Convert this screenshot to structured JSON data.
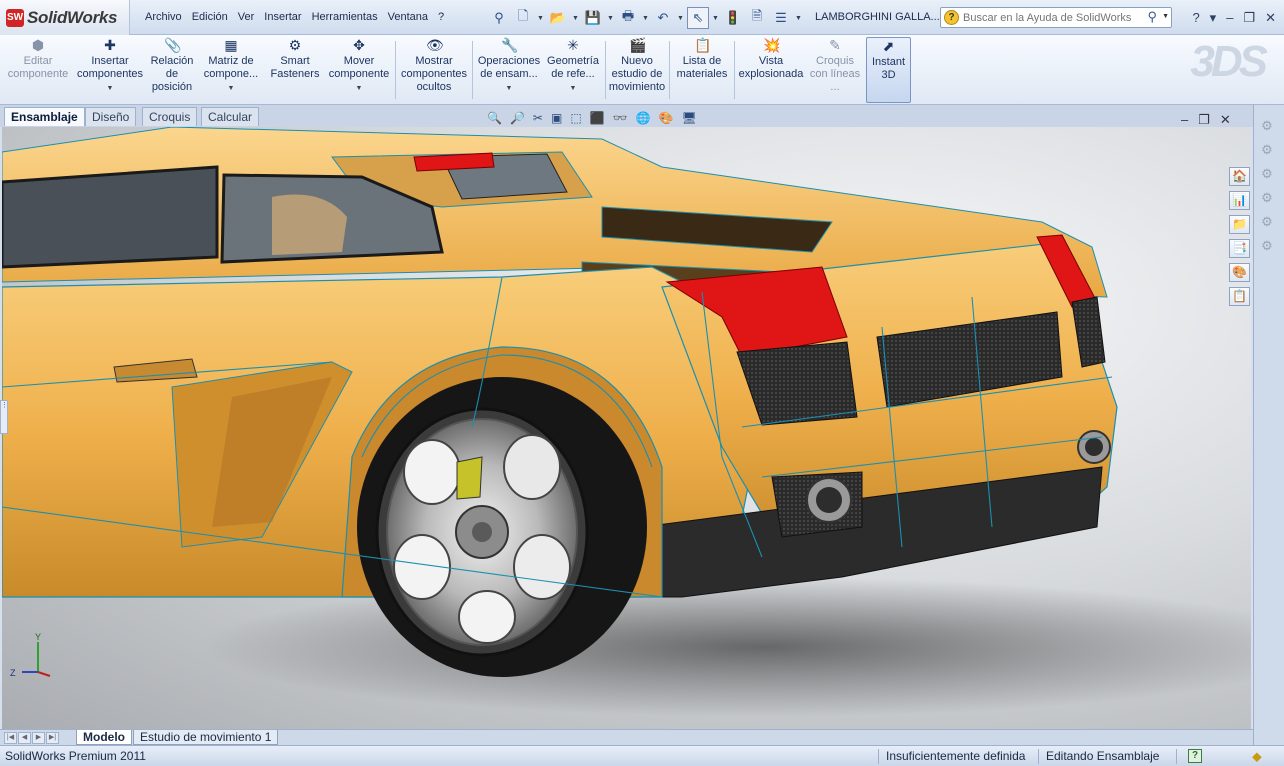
{
  "app": {
    "name": "SolidWorks",
    "logo_mark": "SW",
    "document_title": "LAMBORGHINI GALLA...",
    "product": "SolidWorks Premium 2011"
  },
  "menu": [
    "Archivo",
    "Edición",
    "Ver",
    "Insertar",
    "Herramientas",
    "Ventana",
    "?"
  ],
  "quick_access": [
    {
      "name": "pin-icon",
      "glyph": "⚲"
    },
    {
      "name": "new-document-icon",
      "glyph": "🗋"
    },
    {
      "name": "open-folder-icon",
      "glyph": "📂"
    },
    {
      "name": "save-icon",
      "glyph": "💾"
    },
    {
      "name": "print-icon",
      "glyph": "🖶"
    },
    {
      "name": "undo-icon",
      "glyph": "↶"
    },
    {
      "name": "select-pointer-icon",
      "glyph": "⇖"
    },
    {
      "name": "rebuild-traffic-light-icon",
      "glyph": "🚦"
    },
    {
      "name": "file-properties-icon",
      "glyph": "🗎"
    },
    {
      "name": "options-icon",
      "glyph": "☰"
    }
  ],
  "help_search": {
    "placeholder": "Buscar en la Ayuda de SolidWorks"
  },
  "window_controls": [
    "?",
    "▾",
    "–",
    "❐",
    "✕"
  ],
  "command_manager": [
    {
      "label": "Editar componente",
      "glyph": "⬢",
      "disabled": true,
      "caret": false
    },
    {
      "label": "Insertar componentes",
      "glyph": "✚",
      "disabled": false,
      "caret": true
    },
    {
      "label": "Relación de posición",
      "glyph": "📎",
      "disabled": false,
      "caret": false
    },
    {
      "label": "Matriz de compone...",
      "glyph": "▦",
      "disabled": false,
      "caret": true
    },
    {
      "label": "Smart Fasteners",
      "glyph": "⚙",
      "disabled": false,
      "caret": false
    },
    {
      "label": "Mover componente",
      "glyph": "✥",
      "disabled": false,
      "caret": true
    },
    {
      "label": "Mostrar componentes ocultos",
      "glyph": "👁",
      "disabled": false,
      "caret": false
    },
    {
      "label": "Operaciones de ensam...",
      "glyph": "🔧",
      "disabled": false,
      "caret": true
    },
    {
      "label": "Geometría de refe...",
      "glyph": "✳",
      "disabled": false,
      "caret": true
    },
    {
      "label": "Nuevo estudio de movimiento",
      "glyph": "🎬",
      "disabled": false,
      "caret": false
    },
    {
      "label": "Lista de materiales",
      "glyph": "📋",
      "disabled": false,
      "caret": false
    },
    {
      "label": "Vista explosionada",
      "glyph": "💥",
      "disabled": false,
      "caret": false
    },
    {
      "label": "Croquis con líneas ...",
      "glyph": "✎",
      "disabled": true,
      "caret": false
    },
    {
      "label": "Instant 3D",
      "glyph": "⬈",
      "disabled": false,
      "caret": false,
      "active": true
    }
  ],
  "tabs": [
    {
      "label": "Ensamblaje",
      "active": true
    },
    {
      "label": "Diseño",
      "active": false
    },
    {
      "label": "Croquis",
      "active": false
    },
    {
      "label": "Calcular",
      "active": false
    }
  ],
  "heads_up_toolbar": [
    "🔍",
    "🔎",
    "✂",
    "▣",
    "⬚",
    "⬛",
    "👓",
    "🌐",
    "🎨",
    "🖥"
  ],
  "viewport_controls": [
    "–",
    "❐",
    "✕"
  ],
  "task_pane": [
    "🏠",
    "📊",
    "📁",
    "📑",
    "🎨",
    "📋"
  ],
  "task_pane_faded": [
    "⚙",
    "⚙",
    "⚙",
    "⚙",
    "⚙",
    "⚙"
  ],
  "triad": {
    "y": "Y",
    "z": "Z"
  },
  "bottom_tabs": [
    {
      "label": "Modelo",
      "active": true
    },
    {
      "label": "Estudio de movimiento 1",
      "active": false
    }
  ],
  "status": {
    "definition": "Insuficientemente definida",
    "mode": "Editando Ensamblaje",
    "help": "?"
  },
  "colors": {
    "car_body": "#f1b24f",
    "taillight": "#e01515",
    "edge_lines": "#1b8fb0",
    "accent": "#2d4f86"
  }
}
